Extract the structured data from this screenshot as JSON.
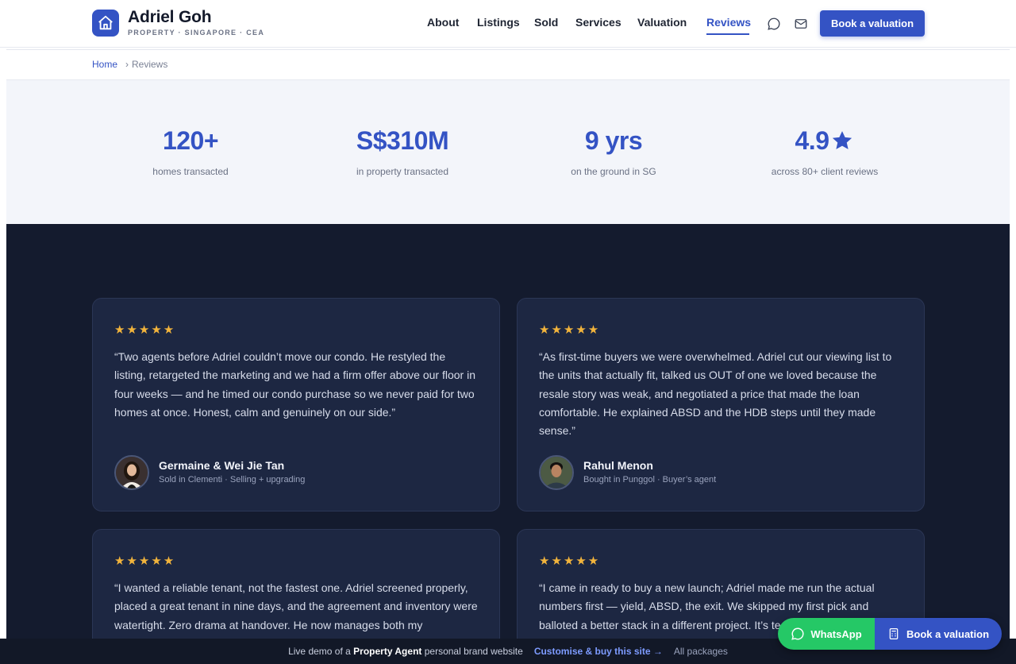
{
  "brand": {
    "name": "Adriel Goh",
    "subtitle": "PROPERTY · SINGAPORE · CEA",
    "logo_icon": "house-icon"
  },
  "nav": {
    "items": [
      {
        "label": "About"
      },
      {
        "label": "Listings"
      },
      {
        "label": "Sold"
      },
      {
        "label": "Services"
      },
      {
        "label": "Valuation"
      },
      {
        "label": "Reviews",
        "active": true
      }
    ],
    "chat_icon": "chat-bubble-icon",
    "mail_icon": "mail-icon",
    "cta_label": "Book a valuation"
  },
  "breadcrumb": {
    "home": "Home",
    "separator": "›",
    "current": "Reviews"
  },
  "stats": [
    {
      "value": "120+",
      "label": "homes transacted"
    },
    {
      "value": "S$310M",
      "label": "in property transacted"
    },
    {
      "value": "9 yrs",
      "label": "on the ground in SG"
    },
    {
      "value": "4.9",
      "label": "across 80+ client reviews",
      "icon": "star-icon"
    }
  ],
  "reviews": [
    {
      "stars": "★★★★★",
      "rating": 5,
      "quote": "“Two agents before Adriel couldn’t move our condo. He restyled the listing, retargeted the marketing and we had a firm offer above our floor in four weeks — and he timed our condo purchase so we never paid for two homes at once. Honest, calm and genuinely on our side.”",
      "name": "Germaine & Wei Jie Tan",
      "meta": "Sold in Clementi · Selling + upgrading"
    },
    {
      "stars": "★★★★★",
      "rating": 5,
      "quote": "“As first-time buyers we were overwhelmed. Adriel cut our viewing list to the units that actually fit, talked us OUT of one we loved because the resale story was weak, and negotiated a price that made the loan comfortable. He explained ABSD and the HDB steps until they made sense.”",
      "name": "Rahul Menon",
      "meta": "Bought in Punggol · Buyer’s agent"
    },
    {
      "stars": "★★★★★",
      "rating": 5,
      "quote": "“I wanted a reliable tenant, not the fastest one. Adriel screened properly, placed a great tenant in nine days, and the agreement and inventory were watertight. Zero drama at handover. He now manages both my",
      "name": "",
      "meta": ""
    },
    {
      "stars": "★★★★★",
      "rating": 5,
      "quote": "“I came in ready to buy a new launch; Adriel made me run the actual numbers first — yield, ABSD, the exit. We skipped my first pick and balloted a better stack in a different project. It’s te",
      "name": "",
      "meta": ""
    }
  ],
  "bottom_bar": {
    "prefix": "Live demo of a",
    "bold": "Property Agent",
    "suffix": "personal brand website",
    "link": "Customise & buy this site →",
    "muted": "All packages"
  },
  "floating": {
    "whatsapp_label": "WhatsApp",
    "whatsapp_icon": "whatsapp-icon",
    "book_label": "Book a valuation",
    "book_icon": "calculator-icon"
  },
  "colors": {
    "accent": "#3453c4",
    "dark_bg": "#141b2e",
    "card_bg": "#1d2742",
    "star": "#f2b43c",
    "whatsapp": "#25c866"
  }
}
